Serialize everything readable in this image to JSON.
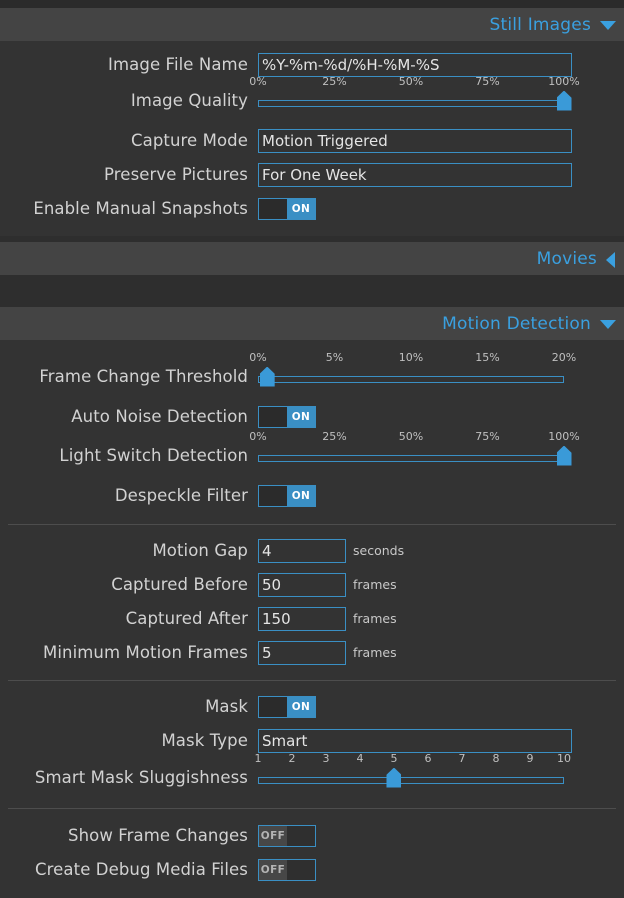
{
  "sections": {
    "still_images": {
      "title": "Still Images",
      "caret": "chevron-down-icon",
      "expanded": true,
      "rows": {
        "image_file_name": {
          "label": "Image File Name",
          "value": "%Y-%m-%d/%H-%M-%S"
        },
        "image_quality": {
          "label": "Image Quality",
          "ticks": [
            "0%",
            "25%",
            "50%",
            "75%",
            "100%"
          ],
          "value": 100,
          "min": 0,
          "max": 100
        },
        "capture_mode": {
          "label": "Capture Mode",
          "value": "Motion Triggered"
        },
        "preserve_pictures": {
          "label": "Preserve Pictures",
          "value": "For One Week"
        },
        "enable_manual_snapshots": {
          "label": "Enable Manual Snapshots",
          "state": "ON"
        }
      }
    },
    "movies": {
      "title": "Movies",
      "caret": "chevron-left-icon",
      "expanded": false
    },
    "motion_detection": {
      "title": "Motion Detection",
      "caret": "chevron-down-icon",
      "expanded": true,
      "rows": {
        "frame_change_threshold": {
          "label": "Frame Change Threshold",
          "ticks": [
            "0%",
            "5%",
            "10%",
            "15%",
            "20%"
          ],
          "value": 0.6,
          "min": 0,
          "max": 20
        },
        "auto_noise_detection": {
          "label": "Auto Noise Detection",
          "state": "ON"
        },
        "light_switch_detection": {
          "label": "Light Switch Detection",
          "ticks": [
            "0%",
            "25%",
            "50%",
            "75%",
            "100%"
          ],
          "value": 100,
          "min": 0,
          "max": 100
        },
        "despeckle_filter": {
          "label": "Despeckle Filter",
          "state": "ON"
        },
        "motion_gap": {
          "label": "Motion Gap",
          "value": "4",
          "unit": "seconds"
        },
        "captured_before": {
          "label": "Captured Before",
          "value": "50",
          "unit": "frames"
        },
        "captured_after": {
          "label": "Captured After",
          "value": "150",
          "unit": "frames"
        },
        "minimum_motion_frames": {
          "label": "Minimum Motion Frames",
          "value": "5",
          "unit": "frames"
        },
        "mask": {
          "label": "Mask",
          "state": "ON"
        },
        "mask_type": {
          "label": "Mask Type",
          "value": "Smart"
        },
        "smart_mask_sluggishness": {
          "label": "Smart Mask Sluggishness",
          "ticks": [
            "1",
            "2",
            "3",
            "4",
            "5",
            "6",
            "7",
            "8",
            "9",
            "10"
          ],
          "value": 5,
          "min": 1,
          "max": 10
        },
        "show_frame_changes": {
          "label": "Show Frame Changes",
          "state": "OFF"
        },
        "create_debug_media_files": {
          "label": "Create Debug Media Files",
          "state": "OFF"
        }
      }
    }
  },
  "colors": {
    "accent": "#3a9ad8",
    "header_text": "#3aa0e0",
    "label_text": "#d2d2d2",
    "header_bar": "#444444",
    "body_bg": "#333333",
    "page_bg": "#2b2b2b",
    "field_border": "#3a8fc4"
  }
}
